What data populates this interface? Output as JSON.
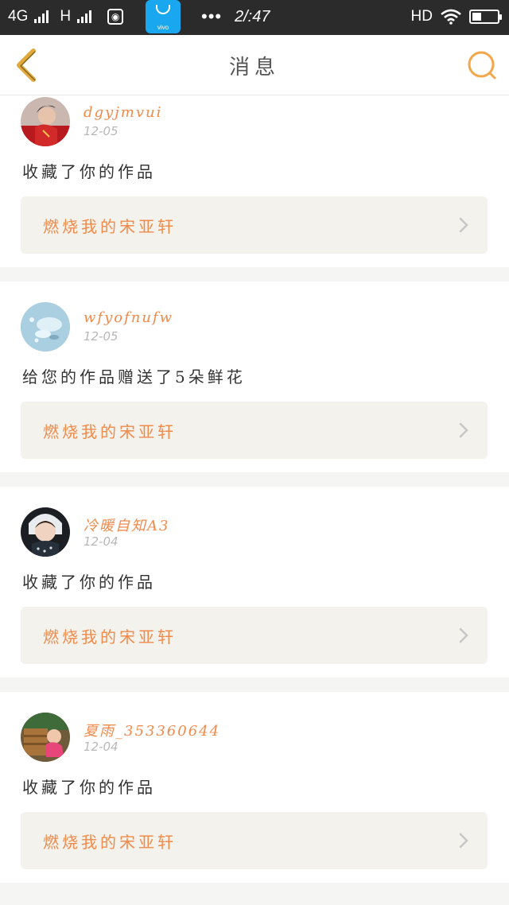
{
  "status_bar": {
    "network": "4G",
    "network2": "H",
    "time": "2/:47",
    "hd": "HD",
    "store_label": "vivo",
    "dots": "•••",
    "battery_level": 0.35
  },
  "nav": {
    "title": "消息",
    "back_icon": "chevron-left-icon",
    "search_icon": "search-icon",
    "accent_color": "#f4a64a"
  },
  "messages": [
    {
      "username": "dgyjmvui",
      "date": "12-05",
      "action": "收藏了你的作品",
      "work_title": "燃烧我的宋亚轩",
      "avatar": "woman-red-dress"
    },
    {
      "username": "wfyofnufw",
      "date": "12-05",
      "action": "给您的作品赠送了5朵鲜花",
      "work_title": "燃烧我的宋亚轩",
      "avatar": "water-drops"
    },
    {
      "username": "冷暖自知A3",
      "date": "12-04",
      "action": "收藏了你的作品",
      "work_title": "燃烧我的宋亚轩",
      "avatar": "child-portrait"
    },
    {
      "username": "夏雨_353360644",
      "date": "12-04",
      "action": "收藏了你的作品",
      "work_title": "燃烧我的宋亚轩",
      "avatar": "baby-on-bench"
    }
  ]
}
